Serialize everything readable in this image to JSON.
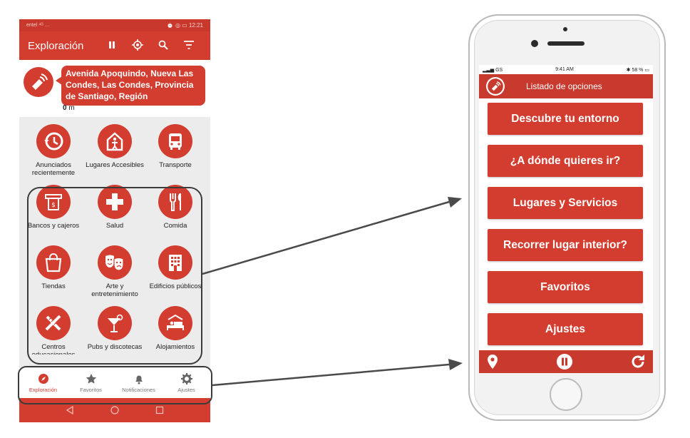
{
  "colors": {
    "accent": "#d23d30",
    "dark_accent": "#c83a2d",
    "annotation": "#3b3b3b"
  },
  "android": {
    "status_left": "entel ⁴ᴳ …",
    "status_time": "12:21",
    "title": "Exploración",
    "actions": [
      "pause-icon",
      "locate-icon",
      "search-icon",
      "filter-icon"
    ],
    "address": "Avenida Apoquindo, Nueva Las Condes, Las Condes, Provincia de Santiago, Región",
    "distance_value": "0",
    "distance_unit": "m",
    "categories": [
      {
        "label": "Anunciados recientemente",
        "icon": "history-icon"
      },
      {
        "label": "Lugares Accesibles",
        "icon": "accessible-place-icon"
      },
      {
        "label": "Transporte",
        "icon": "bus-icon"
      },
      {
        "label": "Bancos y cajeros",
        "icon": "atm-icon"
      },
      {
        "label": "Salud",
        "icon": "health-cross-icon"
      },
      {
        "label": "Comida",
        "icon": "cutlery-icon"
      },
      {
        "label": "Tiendas",
        "icon": "shopping-bag-icon"
      },
      {
        "label": "Arte y entretenimiento",
        "icon": "theater-masks-icon"
      },
      {
        "label": "Edificios públicos",
        "icon": "building-icon"
      },
      {
        "label": "Centros educacionales",
        "icon": "school-icon"
      },
      {
        "label": "Pubs y discotecas",
        "icon": "cocktail-icon"
      },
      {
        "label": "Alojamientos",
        "icon": "bed-icon"
      }
    ],
    "bottom_nav": [
      {
        "label": "Exploración",
        "icon": "compass-icon",
        "active": true
      },
      {
        "label": "Favoritos",
        "icon": "star-icon",
        "active": false
      },
      {
        "label": "Notificaciones",
        "icon": "bell-icon",
        "active": false
      },
      {
        "label": "Ajustes",
        "icon": "gear-icon",
        "active": false
      }
    ]
  },
  "iphone": {
    "carrier": "GS",
    "time": "9:41 AM",
    "battery": "58 %",
    "header_title": "Listado de opciones",
    "options": [
      "Descubre tu entorno",
      "¿A dónde quieres ir?",
      "Lugares y Servicios",
      "Recorrer lugar interior?",
      "Favoritos",
      "Ajustes"
    ],
    "footer_icons": [
      "location-pin-icon",
      "pause-icon",
      "refresh-icon"
    ]
  }
}
